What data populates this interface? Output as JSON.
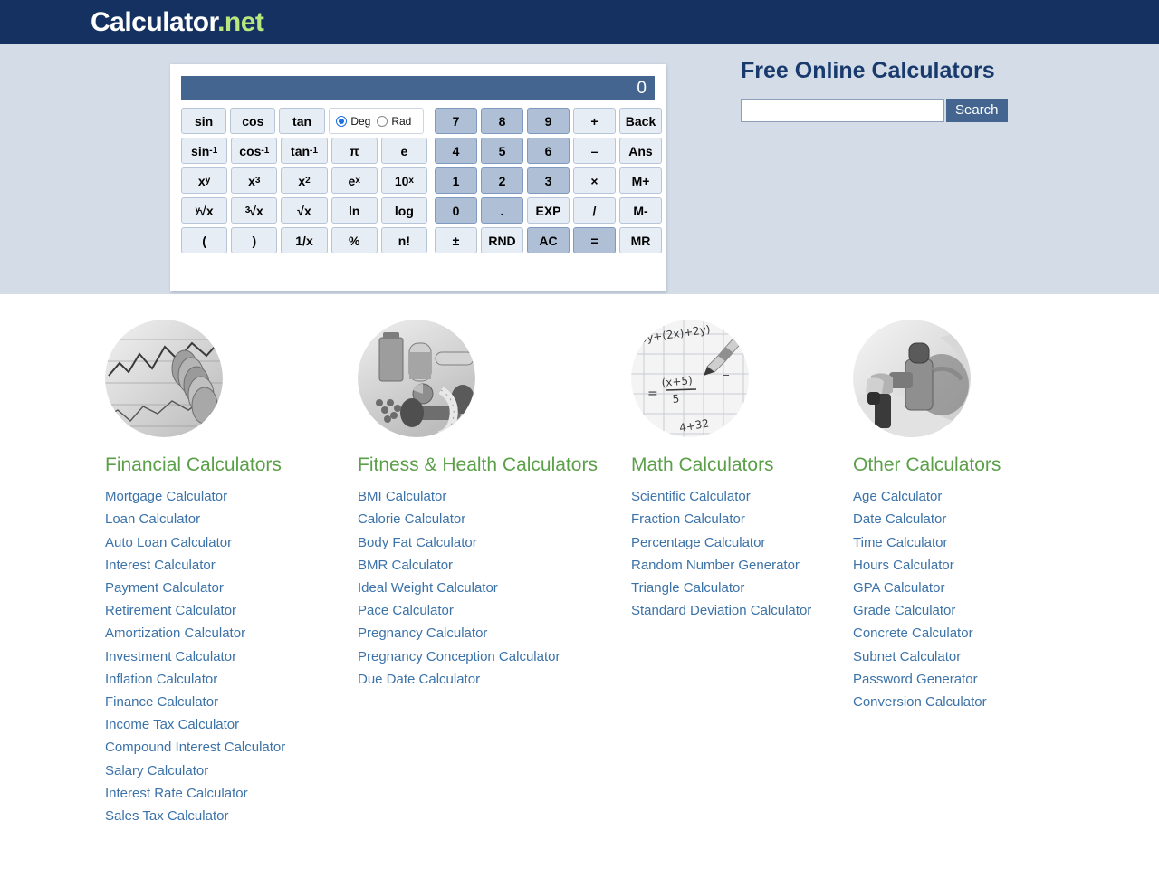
{
  "header": {
    "logo_word": "Calculator",
    "logo_dot": ".",
    "logo_tld": "net",
    "bg_color": "#143161"
  },
  "banner": {
    "bg_color": "#d3dce7",
    "site_title": "Free Online Calculators",
    "search": {
      "value": "",
      "placeholder": "",
      "button_label": "Search",
      "button_color": "#436590"
    }
  },
  "calculator": {
    "display_value": "0",
    "display_color": "#436590",
    "angle_mode": {
      "deg_label": "Deg",
      "rad_label": "Rad",
      "selected": "Deg"
    },
    "sci_rows": [
      [
        {
          "label": "sin"
        },
        {
          "label": "cos"
        },
        {
          "label": "tan"
        },
        {
          "type": "degrad"
        }
      ],
      [
        {
          "label": "sin",
          "sup": "-1"
        },
        {
          "label": "cos",
          "sup": "-1"
        },
        {
          "label": "tan",
          "sup": "-1"
        },
        {
          "label": "π"
        },
        {
          "label": "e"
        }
      ],
      [
        {
          "label": "x",
          "sup": "y"
        },
        {
          "label": "x",
          "sup": "3"
        },
        {
          "label": "x",
          "sup": "2"
        },
        {
          "label": "e",
          "sup": "x"
        },
        {
          "label": "10",
          "sup": "x"
        }
      ],
      [
        {
          "pre": "y",
          "label": "√x"
        },
        {
          "pre": "3",
          "label": "√x"
        },
        {
          "label": "√x"
        },
        {
          "label": "ln"
        },
        {
          "label": "log"
        }
      ],
      [
        {
          "label": "("
        },
        {
          "label": ")"
        },
        {
          "label": "1/x"
        },
        {
          "label": "%"
        },
        {
          "label": "n!"
        }
      ]
    ],
    "num_rows": [
      [
        {
          "label": "7",
          "dark": true
        },
        {
          "label": "8",
          "dark": true
        },
        {
          "label": "9",
          "dark": true
        },
        {
          "label": "+",
          "dark": false
        },
        {
          "label": "Back",
          "dark": false
        }
      ],
      [
        {
          "label": "4",
          "dark": true
        },
        {
          "label": "5",
          "dark": true
        },
        {
          "label": "6",
          "dark": true
        },
        {
          "label": "–",
          "dark": false
        },
        {
          "label": "Ans",
          "dark": false
        }
      ],
      [
        {
          "label": "1",
          "dark": true
        },
        {
          "label": "2",
          "dark": true
        },
        {
          "label": "3",
          "dark": true
        },
        {
          "label": "×",
          "dark": false
        },
        {
          "label": "M+",
          "dark": false
        }
      ],
      [
        {
          "label": "0",
          "dark": true
        },
        {
          "label": ".",
          "dark": true
        },
        {
          "label": "EXP",
          "dark": false
        },
        {
          "label": "/",
          "dark": false
        },
        {
          "label": "M-",
          "dark": false
        }
      ],
      [
        {
          "label": "±",
          "dark": false
        },
        {
          "label": "RND",
          "dark": false
        },
        {
          "label": "AC",
          "dark": true
        },
        {
          "label": "=",
          "dark": true
        },
        {
          "label": "MR",
          "dark": false
        }
      ]
    ]
  },
  "categories": [
    {
      "title": "Financial Calculators",
      "image": "coins-on-financial-chart-photo",
      "links": [
        "Mortgage Calculator",
        "Loan Calculator",
        "Auto Loan Calculator",
        "Interest Calculator",
        "Payment Calculator",
        "Retirement Calculator",
        "Amortization Calculator",
        "Investment Calculator",
        "Inflation Calculator",
        "Finance Calculator",
        "Income Tax Calculator",
        "Compound Interest Calculator",
        "Salary Calculator",
        "Interest Rate Calculator",
        "Sales Tax Calculator"
      ]
    },
    {
      "title": "Fitness & Health Calculators",
      "image": "healthy-food-and-dumbbell-photo",
      "links": [
        "BMI Calculator",
        "Calorie Calculator",
        "Body Fat Calculator",
        "BMR Calculator",
        "Ideal Weight Calculator",
        "Pace Calculator",
        "Pregnancy Calculator",
        "Pregnancy Conception Calculator",
        "Due Date Calculator"
      ]
    },
    {
      "title": "Math Calculators",
      "image": "pencil-on-graph-paper-equation-photo",
      "links": [
        "Scientific Calculator",
        "Fraction Calculator",
        "Percentage Calculator",
        "Random Number Generator",
        "Triangle Calculator",
        "Standard Deviation Calculator"
      ]
    },
    {
      "title": "Other Calculators",
      "image": "fuel-pump-nozzle-photo",
      "links": [
        "Age Calculator",
        "Date Calculator",
        "Time Calculator",
        "Hours Calculator",
        "GPA Calculator",
        "Grade Calculator",
        "Concrete Calculator",
        "Subnet Calculator",
        "Password Generator",
        "Conversion Calculator"
      ]
    }
  ],
  "colors": {
    "link": "#3b72a8",
    "category_title": "#5ba049",
    "navy": "#143161",
    "accent_green": "#b9e77f"
  }
}
